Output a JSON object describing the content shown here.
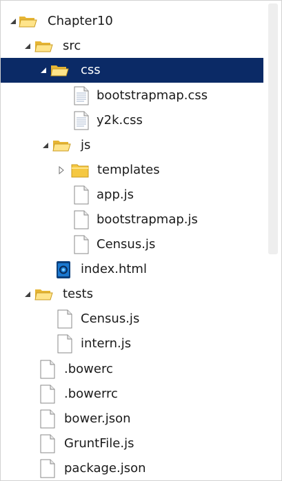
{
  "tree": {
    "items": [
      {
        "label": "Chapter10",
        "type": "folder-open",
        "expander": "expanded",
        "selected": false
      },
      {
        "label": "src",
        "type": "folder-open",
        "expander": "expanded",
        "selected": false
      },
      {
        "label": "css",
        "type": "folder-open",
        "expander": "expanded",
        "selected": true
      },
      {
        "label": "bootstrapmap.css",
        "type": "css-file",
        "expander": "none",
        "selected": false
      },
      {
        "label": "y2k.css",
        "type": "css-file",
        "expander": "none",
        "selected": false
      },
      {
        "label": "js",
        "type": "folder-open",
        "expander": "expanded",
        "selected": false
      },
      {
        "label": "templates",
        "type": "folder-closed",
        "expander": "collapsed",
        "selected": false
      },
      {
        "label": "app.js",
        "type": "file",
        "expander": "none",
        "selected": false
      },
      {
        "label": "bootstrapmap.js",
        "type": "file",
        "expander": "none",
        "selected": false
      },
      {
        "label": "Census.js",
        "type": "file",
        "expander": "none",
        "selected": false
      },
      {
        "label": "index.html",
        "type": "html-file",
        "expander": "none",
        "selected": false
      },
      {
        "label": "tests",
        "type": "folder-open",
        "expander": "expanded",
        "selected": false
      },
      {
        "label": "Census.js",
        "type": "file",
        "expander": "none",
        "selected": false
      },
      {
        "label": "intern.js",
        "type": "file",
        "expander": "none",
        "selected": false
      },
      {
        "label": ".bowerc",
        "type": "file",
        "expander": "none",
        "selected": false
      },
      {
        "label": ".bowerrc",
        "type": "file",
        "expander": "none",
        "selected": false
      },
      {
        "label": "bower.json",
        "type": "file",
        "expander": "none",
        "selected": false
      },
      {
        "label": "GruntFile.js",
        "type": "file",
        "expander": "none",
        "selected": false
      },
      {
        "label": "package.json",
        "type": "file",
        "expander": "none",
        "selected": false
      }
    ]
  },
  "colors": {
    "selection": "#0b2a66",
    "folder": "#f5c842",
    "html_icon": "#0d67b5"
  }
}
